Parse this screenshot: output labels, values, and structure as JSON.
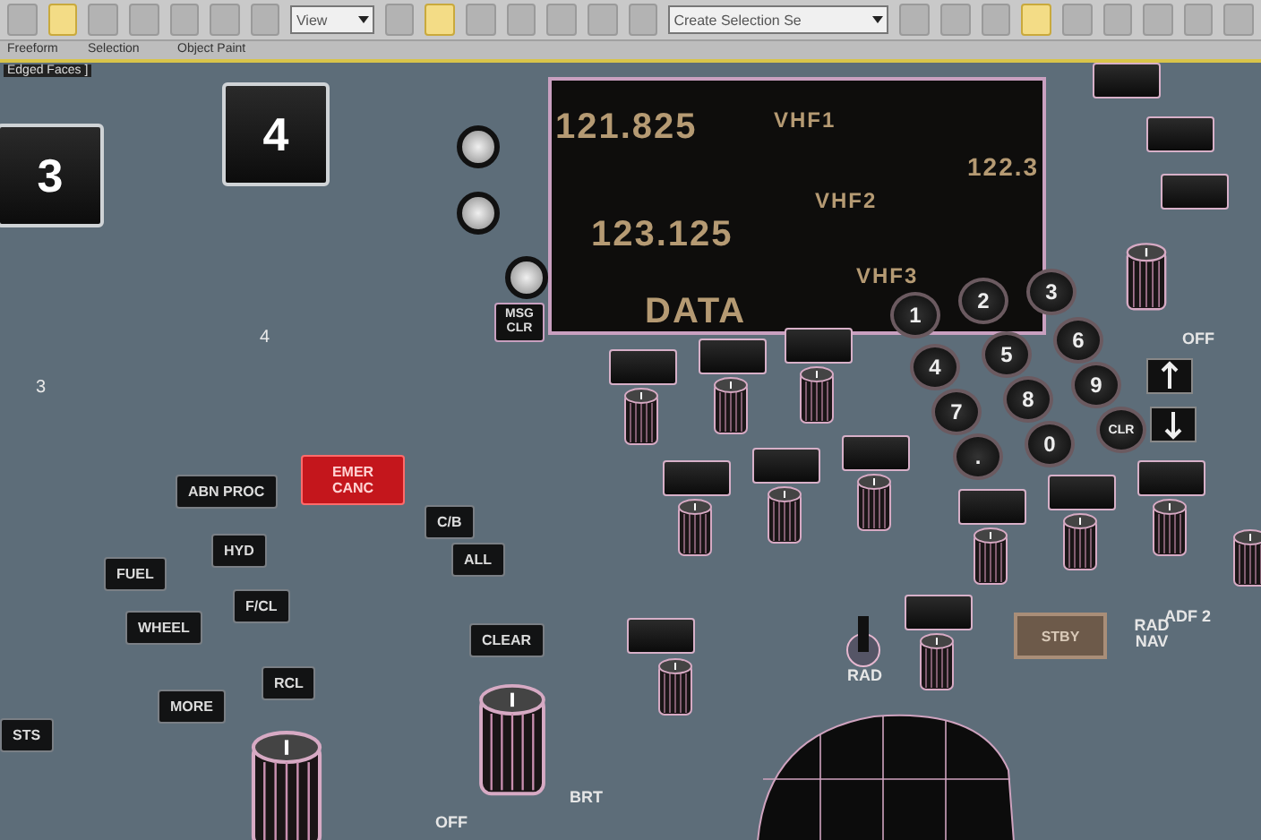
{
  "toolbar": {
    "view_dropdown": "View",
    "selection_dropdown": "Create Selection Se"
  },
  "ribbon_tabs": [
    "Freeform",
    "Selection",
    "Object Paint"
  ],
  "viewport": {
    "label": "Edged Faces ]"
  },
  "big_keys": [
    {
      "label": "3",
      "caption": "3"
    },
    {
      "label": "4",
      "caption": "4"
    }
  ],
  "msg_button": "MSG CLR",
  "display": {
    "rows": [
      {
        "frequency": "121.825",
        "channel": "VHF1",
        "standby": "122.3"
      },
      {
        "frequency": "123.125",
        "channel": "VHF2"
      },
      {
        "frequency": "DATA",
        "channel": "VHF3"
      }
    ]
  },
  "keypad": [
    "1",
    "2",
    "3",
    "4",
    "5",
    "6",
    "7",
    "8",
    "9",
    ".",
    "0",
    "CLR"
  ],
  "knob_labels": [
    "OFF",
    "OFF",
    "BRT",
    "RAD",
    "ADF 2",
    "RAD NAV"
  ],
  "stby_button": "STBY",
  "ecam_buttons": [
    {
      "label": "ABN PROC",
      "kind": "normal"
    },
    {
      "label": "EMER CANC",
      "kind": "alert"
    },
    {
      "label": "C/B",
      "kind": "normal"
    },
    {
      "label": "FUEL",
      "kind": "normal"
    },
    {
      "label": "HYD",
      "kind": "normal"
    },
    {
      "label": "ALL",
      "kind": "normal"
    },
    {
      "label": "WHEEL",
      "kind": "normal"
    },
    {
      "label": "F/CL",
      "kind": "normal"
    },
    {
      "label": "CLEAR",
      "kind": "normal"
    },
    {
      "label": "MORE",
      "kind": "normal"
    },
    {
      "label": "RCL",
      "kind": "normal"
    },
    {
      "label": "STS",
      "kind": "normal"
    }
  ]
}
